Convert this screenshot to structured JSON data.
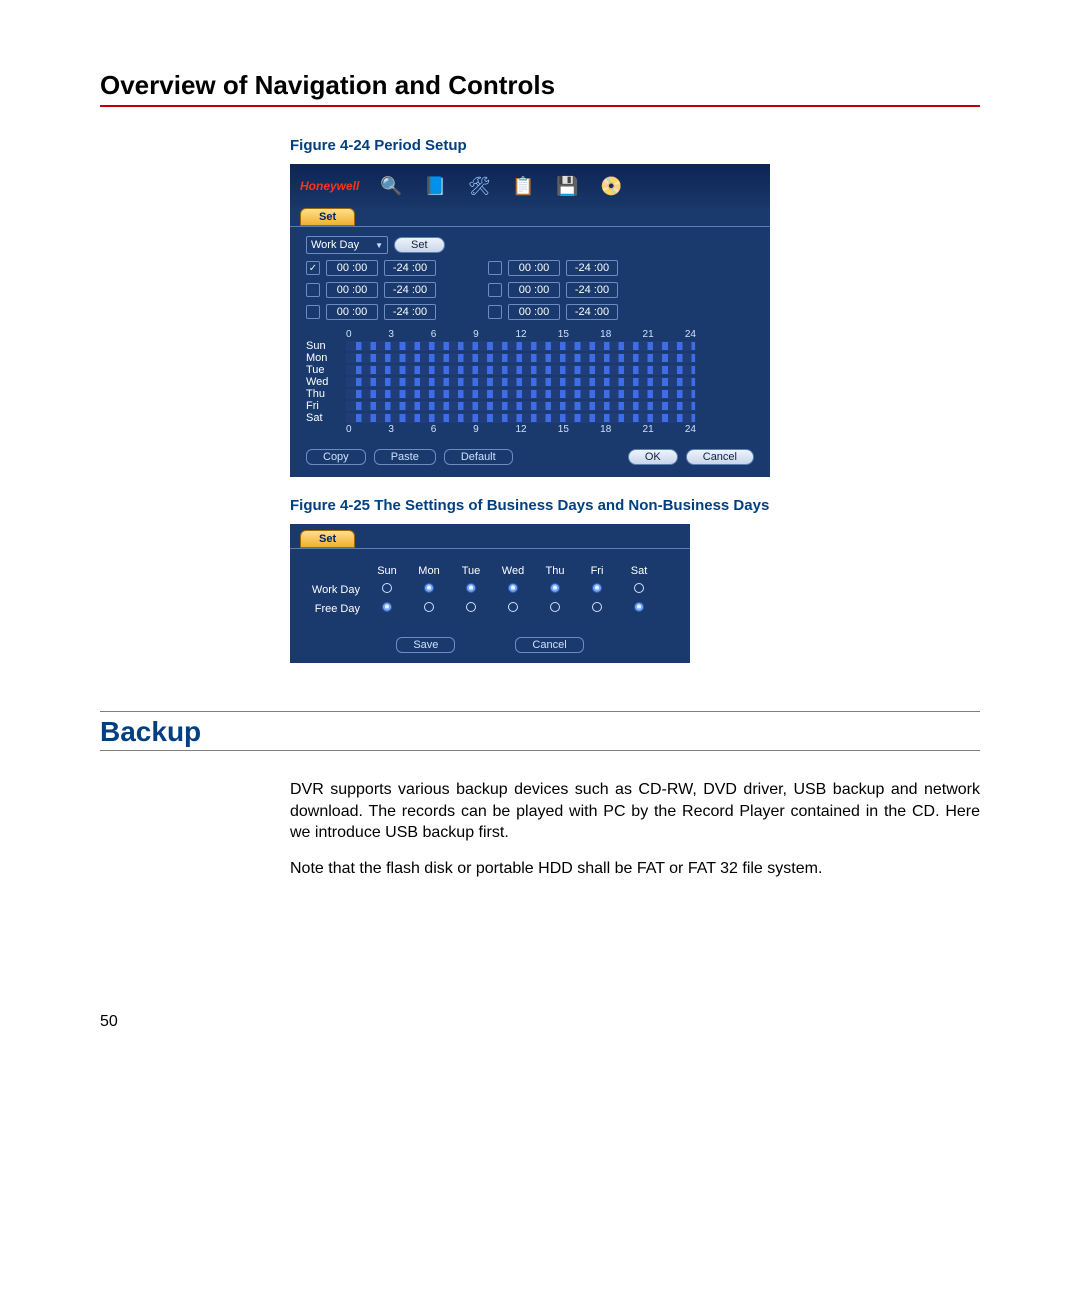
{
  "page_title": "Overview of Navigation and Controls",
  "fig1": {
    "caption": "Figure 4-24 Period Setup",
    "brand": "Honeywell",
    "tab_label": "Set",
    "combo_label": "Work Day",
    "set_button": "Set",
    "ticks": [
      "0",
      "3",
      "6",
      "9",
      "12",
      "15",
      "18",
      "21",
      "24"
    ],
    "days": [
      "Sun",
      "Mon",
      "Tue",
      "Wed",
      "Thu",
      "Fri",
      "Sat"
    ],
    "periods": [
      {
        "checked": true,
        "start": "00 :00",
        "end": "-24 :00",
        "start2": "00 :00",
        "end2": "-24 :00"
      },
      {
        "checked": false,
        "start": "00 :00",
        "end": "-24 :00",
        "start2": "00 :00",
        "end2": "-24 :00"
      },
      {
        "checked": false,
        "start": "00 :00",
        "end": "-24 :00",
        "start2": "00 :00",
        "end2": "-24 :00"
      }
    ],
    "buttons": {
      "copy": "Copy",
      "paste": "Paste",
      "default": "Default",
      "ok": "OK",
      "cancel": "Cancel"
    }
  },
  "fig2": {
    "caption": "Figure 4-25 The Settings of Business Days and Non-Business Days",
    "tab_label": "Set",
    "days": [
      "Sun",
      "Mon",
      "Tue",
      "Wed",
      "Thu",
      "Fri",
      "Sat"
    ],
    "rows": [
      {
        "label": "Work Day",
        "values": [
          false,
          true,
          true,
          true,
          true,
          true,
          false
        ]
      },
      {
        "label": "Free Day",
        "values": [
          true,
          false,
          false,
          false,
          false,
          false,
          true
        ]
      }
    ],
    "buttons": {
      "save": "Save",
      "cancel": "Cancel"
    }
  },
  "section_heading": "Backup",
  "para1": "DVR supports various backup devices such as CD-RW, DVD driver, USB backup and network download. The records can be played with PC by the Record Player contained in the CD. Here we introduce USB backup first.",
  "para2": "Note that the flash disk or portable HDD shall be FAT or FAT 32 file system.",
  "page_number": "50"
}
